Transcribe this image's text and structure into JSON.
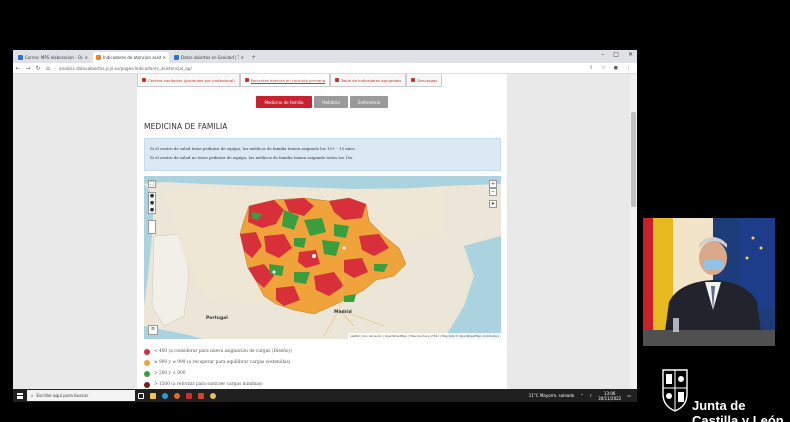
{
  "browser": {
    "tabs": [
      {
        "label": "Correo: MPS elaboracion - Ou",
        "active": false,
        "color": "#2f6fd6"
      },
      {
        "label": "Indicadores de atencion asiste",
        "active": true,
        "color": "#e58a2b"
      },
      {
        "label": "Datos abiertos en Sanidad | Tra",
        "active": false,
        "color": "#2f6fd6"
      }
    ],
    "new_tab": "+",
    "url": "analisis.datosabiertos.jcyl.es/pages/indicadores_asistencial_ap/",
    "window_controls": [
      "–",
      "□",
      "✕"
    ]
  },
  "page": {
    "top_tabs": [
      {
        "label": "Centros sanitarios (pacientes por profesional)",
        "selected": false
      },
      {
        "label": "Pacientes demora en consulta primaria",
        "selected": true
      },
      {
        "label": "Tabla de indicadores agrupados",
        "selected": false
      },
      {
        "label": "Descargas",
        "selected": false
      }
    ],
    "pills": [
      "Medicina de familia",
      "Pediatría",
      "Enfermería"
    ],
    "section_title": "MEDICINA DE FAMILIA",
    "info_lines": [
      "Si el centro de salud tiene pediatra de equipo, los médicos de familia tienen asignado los 15+ - 15 años.",
      "Si el centro de salud no tiene pediatra de equipo, los médicos de familia tienen asignado todos los 15s."
    ],
    "map": {
      "zoom_in": "+",
      "zoom_out": "−",
      "label_portugal": "Portugal",
      "label_madrid": "Madrid",
      "attribution": "Leaflet | Con ubicación | OpenStreetMap | Tiles Courtesy of Esri | Map data © OpenStreetMap contributors"
    },
    "legend": [
      {
        "color": "#d7303b",
        "text": "< 400 (a considerar para nueva asignación de cargas (Diseño))"
      },
      {
        "color": "#f0a33a",
        "text": "≥ 900 y ≤ 999 (a recuperar para equilibrar cargas sostenidas)"
      },
      {
        "color": "#3a9e3f",
        "text": "> 500 y < 900"
      },
      {
        "color": "#7a1c1c",
        "text": "> 1500 (a reforzar para sustraer cargas mínimas)"
      }
    ]
  },
  "taskbar": {
    "search_placeholder": "Escribe aquí para buscar",
    "weather": "11°C  Mayorm. soleado",
    "time": "13:06",
    "date": "30/11/2022"
  },
  "logo": {
    "line1": "Junta de",
    "line2": "Castilla y León"
  }
}
